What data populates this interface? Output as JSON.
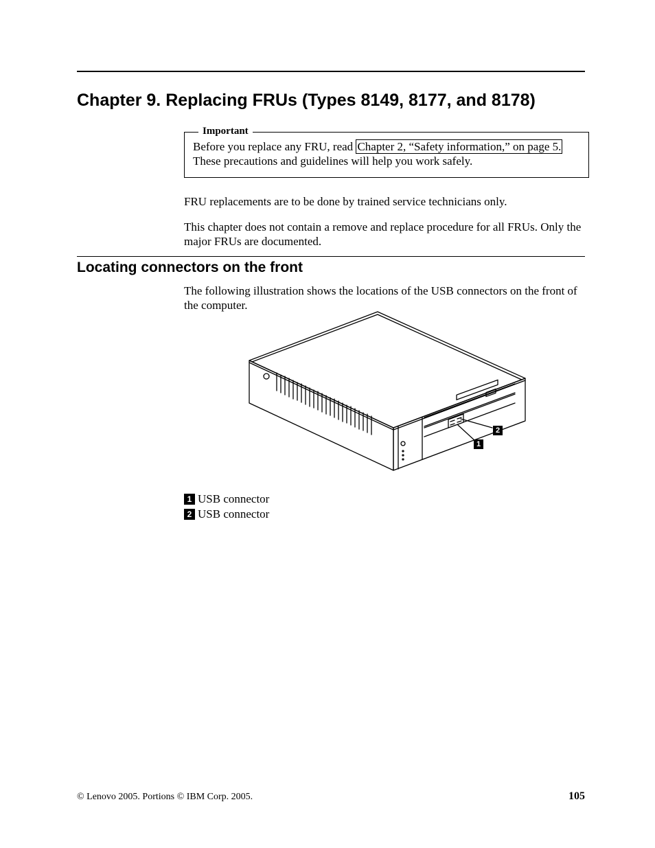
{
  "chapter": {
    "title": "Chapter 9. Replacing FRUs (Types 8149, 8177, and 8178)"
  },
  "important": {
    "legend": "Important",
    "before_text": "Before you replace any FRU, read ",
    "link_text": "Chapter 2, “Safety information,” on page 5.",
    "after_text": " These precautions and guidelines will help you work safely."
  },
  "paragraphs": {
    "p1": "FRU replacements are to be done by trained service technicians only.",
    "p2": "This chapter does not contain a remove and replace procedure for all FRUs. Only the major FRUs are documented."
  },
  "section": {
    "title": "Locating connectors on the front",
    "intro": "The following illustration shows the locations of the USB connectors on the front of the computer."
  },
  "figure": {
    "callouts": {
      "c1": "1",
      "c2": "2"
    }
  },
  "legend": {
    "items": [
      {
        "num": "1",
        "label": "USB connector"
      },
      {
        "num": "2",
        "label": "USB connector"
      }
    ]
  },
  "footer": {
    "copyright": "© Lenovo 2005. Portions © IBM Corp. 2005.",
    "pagenum": "105"
  }
}
